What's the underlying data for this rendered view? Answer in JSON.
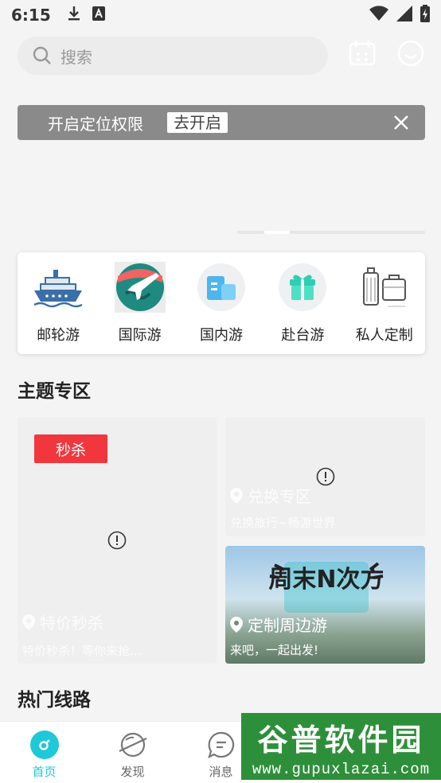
{
  "status_bar": {
    "time": "6:15"
  },
  "search": {
    "placeholder": "搜索"
  },
  "location_prompt": {
    "text": "开启定位权限",
    "button": "去开启"
  },
  "categories": [
    {
      "label": "邮轮游",
      "icon": "cruise-ship-icon"
    },
    {
      "label": "国际游",
      "icon": "globe-plane-icon"
    },
    {
      "label": "国内游",
      "icon": "domestic-buildings-icon"
    },
    {
      "label": "赴台游",
      "icon": "gift-box-icon"
    },
    {
      "label": "私人定制",
      "icon": "luggage-icon"
    }
  ],
  "theme_section": {
    "title": "主题专区",
    "seckill": {
      "badge": "秒杀",
      "title": "特价秒杀",
      "subtitle": "特价秒杀！等你来抢..."
    },
    "exchange": {
      "title": "兑换专区",
      "subtitle": "兑换旅行~畅游世界"
    },
    "weekend": {
      "title": "定制周边游",
      "subtitle": "来吧，一起出发!",
      "poster_text": "周末N次方"
    }
  },
  "hot_routes": {
    "title": "热门线路"
  },
  "tab_bar": [
    {
      "label": "首页",
      "icon": "home-icon",
      "active": true
    },
    {
      "label": "发现",
      "icon": "planet-icon",
      "active": false
    },
    {
      "label": "消息",
      "icon": "chat-icon",
      "active": false
    }
  ],
  "watermark": {
    "title": "谷普软件园",
    "url": "www.gupuxlazai.com"
  },
  "colors": {
    "accent": "#1fc8d8",
    "seckill_red": "#f2363d",
    "location_bar": "#8a8a8a"
  }
}
